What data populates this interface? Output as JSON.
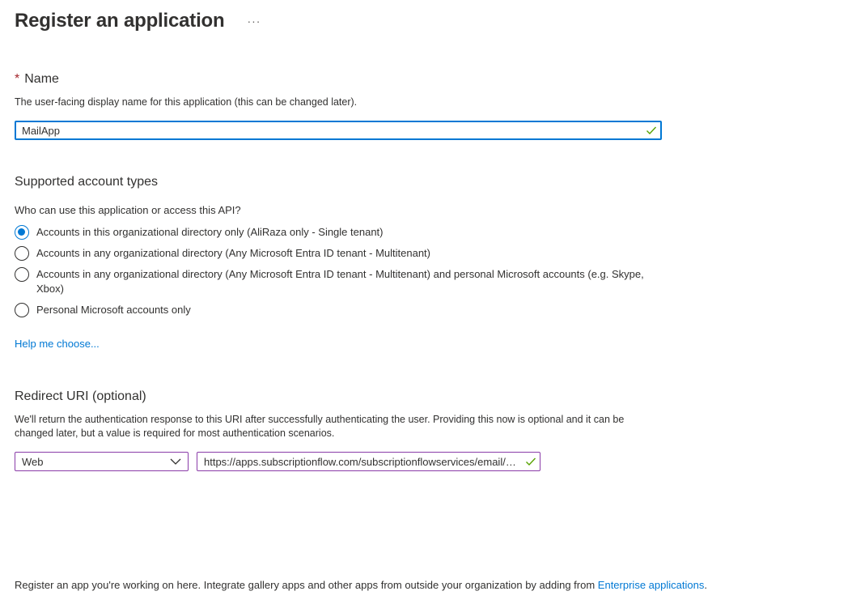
{
  "header": {
    "title": "Register an application",
    "more_label": "···"
  },
  "name_section": {
    "required_mark": "*",
    "title": "Name",
    "description": "The user-facing display name for this application (this can be changed later).",
    "value": "MailApp",
    "valid_icon": "checkmark-icon"
  },
  "account_types": {
    "title": "Supported account types",
    "question": "Who can use this application or access this API?",
    "options": [
      {
        "label": "Accounts in this organizational directory only (AliRaza only - Single tenant)",
        "selected": true
      },
      {
        "label": "Accounts in any organizational directory (Any Microsoft Entra ID tenant - Multitenant)",
        "selected": false
      },
      {
        "label": "Accounts in any organizational directory (Any Microsoft Entra ID tenant - Multitenant) and personal Microsoft accounts (e.g. Skype, Xbox)",
        "selected": false
      },
      {
        "label": "Personal Microsoft accounts only",
        "selected": false
      }
    ],
    "help_link": "Help me choose..."
  },
  "redirect_uri": {
    "title": "Redirect URI (optional)",
    "description": "We'll return the authentication response to this URI after successfully authenticating the user. Providing this now is optional and it can be changed later, but a value is required for most authentication scenarios.",
    "platform_selected": "Web",
    "uri_value": "https://apps.subscriptionflow.com/subscriptionflowservices/email/callback"
  },
  "footer": {
    "text": "Register an app you're working on here. Integrate gallery apps and other apps from outside your organization by adding from ",
    "link": "Enterprise applications",
    "end": "."
  },
  "colors": {
    "accent": "#0078d4",
    "valid_check": "#57a300",
    "field_border": "#8a3ca8",
    "required": "#a4262c"
  }
}
